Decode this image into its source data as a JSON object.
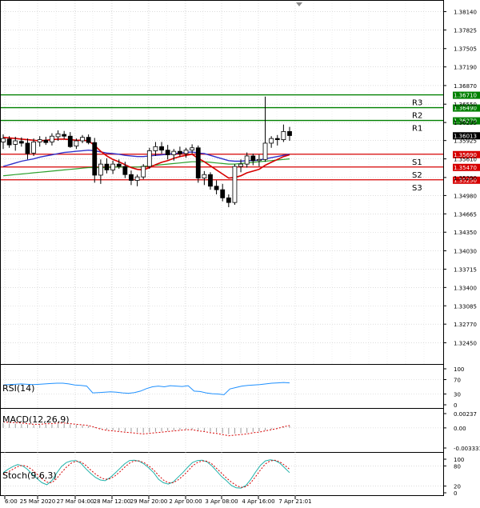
{
  "colors": {
    "background": "#ffffff",
    "grid": "#c8c8c8",
    "bull_candle": "#ffffff",
    "bear_candle": "#000000",
    "support": "#d60000",
    "resistance": "#008000",
    "ma_fast": "#d60000",
    "ma_slow": "#3030c8",
    "ma_long": "#2ca02c",
    "rsi": "#1e90ff",
    "macd": "#d60000",
    "stoch_main": "#20b2aa",
    "stoch_signal": "#d60000"
  },
  "chart_data": [
    {
      "type": "candlestick",
      "name": "price",
      "y_ticks": [
        "1.38140",
        "1.37825",
        "1.37505",
        "1.37190",
        "1.36870",
        "1.36550",
        "1.36235",
        "1.35925",
        "1.35610",
        "1.35290",
        "1.34980",
        "1.34665",
        "1.34350",
        "1.34030",
        "1.33715",
        "1.33400",
        "1.33085",
        "1.32770",
        "1.32450"
      ],
      "ylim": [
        1.3225,
        1.3823
      ],
      "x_ticks": [
        "6:00",
        "25 Mar 2020",
        "27 Mar 04:00",
        "28 Mar 12:00",
        "29 Mar 20:00",
        "2 Apr 00:00",
        "3 Apr 08:00",
        "4 Apr 16:00",
        "7 Apr 21:01"
      ],
      "candles": [
        [
          1.359,
          1.3603,
          1.3578,
          1.3596
        ],
        [
          1.3595,
          1.36,
          1.358,
          1.3585
        ],
        [
          1.3586,
          1.3599,
          1.3575,
          1.3592
        ],
        [
          1.3591,
          1.3598,
          1.3582,
          1.3588
        ],
        [
          1.3588,
          1.3596,
          1.356,
          1.357
        ],
        [
          1.3571,
          1.3596,
          1.3566,
          1.359
        ],
        [
          1.359,
          1.36,
          1.3582,
          1.3594
        ],
        [
          1.3593,
          1.3599,
          1.3585,
          1.3589
        ],
        [
          1.359,
          1.3605,
          1.3584,
          1.36
        ],
        [
          1.3599,
          1.361,
          1.3592,
          1.3604
        ],
        [
          1.3603,
          1.3609,
          1.3595,
          1.36
        ],
        [
          1.36,
          1.3607,
          1.358,
          1.3582
        ],
        [
          1.3583,
          1.3596,
          1.3578,
          1.3592
        ],
        [
          1.3592,
          1.3602,
          1.3588,
          1.3598
        ],
        [
          1.3598,
          1.3603,
          1.3586,
          1.3589
        ],
        [
          1.3589,
          1.3597,
          1.352,
          1.3533
        ],
        [
          1.3533,
          1.356,
          1.3518,
          1.3552
        ],
        [
          1.3552,
          1.3562,
          1.3536,
          1.3542
        ],
        [
          1.3542,
          1.3558,
          1.3535,
          1.3552
        ],
        [
          1.3552,
          1.356,
          1.3544,
          1.3548
        ],
        [
          1.3548,
          1.3556,
          1.3528,
          1.3534
        ],
        [
          1.3534,
          1.3541,
          1.3516,
          1.3524
        ],
        [
          1.3524,
          1.3534,
          1.3514,
          1.353
        ],
        [
          1.353,
          1.3552,
          1.3526,
          1.3548
        ],
        [
          1.3548,
          1.358,
          1.3544,
          1.3575
        ],
        [
          1.3575,
          1.359,
          1.3566,
          1.3582
        ],
        [
          1.3582,
          1.359,
          1.357,
          1.3576
        ],
        [
          1.3576,
          1.3585,
          1.356,
          1.3568
        ],
        [
          1.3568,
          1.3578,
          1.3558,
          1.3574
        ],
        [
          1.3574,
          1.3582,
          1.3565,
          1.357
        ],
        [
          1.357,
          1.358,
          1.3563,
          1.3576
        ],
        [
          1.3576,
          1.3586,
          1.357,
          1.358
        ],
        [
          1.358,
          1.3584,
          1.352,
          1.3528
        ],
        [
          1.3528,
          1.354,
          1.3516,
          1.3534
        ],
        [
          1.3534,
          1.3538,
          1.3508,
          1.3514
        ],
        [
          1.3514,
          1.3524,
          1.35,
          1.3508
        ],
        [
          1.3508,
          1.3518,
          1.3488,
          1.3494
        ],
        [
          1.3494,
          1.35,
          1.3478,
          1.3486
        ],
        [
          1.3486,
          1.3552,
          1.3482,
          1.3548
        ],
        [
          1.3548,
          1.356,
          1.3538,
          1.3552
        ],
        [
          1.3552,
          1.3572,
          1.3546,
          1.3566
        ],
        [
          1.3566,
          1.357,
          1.355,
          1.3558
        ],
        [
          1.3558,
          1.3568,
          1.3548,
          1.356
        ],
        [
          1.356,
          1.3668,
          1.3556,
          1.3588
        ],
        [
          1.3588,
          1.36,
          1.358,
          1.3596
        ],
        [
          1.3596,
          1.3602,
          1.3584,
          1.3594
        ],
        [
          1.3594,
          1.362,
          1.359,
          1.3608
        ],
        [
          1.3608,
          1.3616,
          1.3592,
          1.3601
        ]
      ],
      "ma_fast": [
        1.3598,
        1.3597,
        1.3596,
        1.3595,
        1.3594,
        1.3593,
        1.3592,
        1.3593,
        1.3594,
        1.3595,
        1.3595,
        1.3594,
        1.3593,
        1.3593,
        1.3592,
        1.3584,
        1.3574,
        1.3566,
        1.356,
        1.3556,
        1.3551,
        1.3546,
        1.3543,
        1.3542,
        1.3546,
        1.3551,
        1.3555,
        1.3558,
        1.3562,
        1.3565,
        1.3567,
        1.3569,
        1.3562,
        1.3556,
        1.3549,
        1.3542,
        1.3535,
        1.3528,
        1.3529,
        1.3532,
        1.3537,
        1.354,
        1.3543,
        1.355,
        1.3555,
        1.356,
        1.3565,
        1.3568
      ],
      "ma_slow": [
        1.3548,
        1.3551,
        1.3554,
        1.3557,
        1.3559,
        1.3561,
        1.3564,
        1.3566,
        1.3568,
        1.357,
        1.3572,
        1.3573,
        1.3574,
        1.3575,
        1.3576,
        1.3575,
        1.3573,
        1.3571,
        1.357,
        1.3569,
        1.3567,
        1.3566,
        1.3565,
        1.3565,
        1.3566,
        1.3567,
        1.3568,
        1.3569,
        1.357,
        1.3571,
        1.3572,
        1.3573,
        1.3571,
        1.357,
        1.3567,
        1.3564,
        1.3561,
        1.3558,
        1.3557,
        1.3557,
        1.3558,
        1.3558,
        1.3559,
        1.3561,
        1.3563,
        1.3565,
        1.3567,
        1.3569
      ],
      "ma_long": [
        1.3532,
        1.3533,
        1.3534,
        1.3535,
        1.3536,
        1.3537,
        1.3538,
        1.3539,
        1.354,
        1.3541,
        1.3542,
        1.3543,
        1.3544,
        1.3545,
        1.3546,
        1.3546,
        1.3546,
        1.3546,
        1.3547,
        1.3547,
        1.3547,
        1.3547,
        1.3547,
        1.3548,
        1.3549,
        1.355,
        1.3551,
        1.3552,
        1.3553,
        1.3554,
        1.3555,
        1.3556,
        1.3556,
        1.3556,
        1.3555,
        1.3554,
        1.3553,
        1.3552,
        1.3552,
        1.3553,
        1.3554,
        1.3555,
        1.3556,
        1.3557,
        1.3558,
        1.3559,
        1.356,
        1.3561
      ],
      "levels": [
        {
          "name": "R3",
          "price": 1.3671,
          "label": "1.36710",
          "kind": "resistance"
        },
        {
          "name": "R2",
          "price": 1.3649,
          "label": "1.36490",
          "kind": "resistance"
        },
        {
          "name": "R1",
          "price": 1.3627,
          "label": "1.36270",
          "kind": "resistance"
        },
        {
          "name": "S1",
          "price": 1.3569,
          "label": "1.35690",
          "kind": "support"
        },
        {
          "name": "S2",
          "price": 1.3547,
          "label": "1.35470",
          "kind": "support"
        },
        {
          "name": "S3",
          "price": 1.3525,
          "label": "1.35250",
          "kind": "support"
        }
      ],
      "current_price": {
        "price": 1.36013,
        "label": "1.36013"
      }
    },
    {
      "type": "line",
      "name": "RSI(14)",
      "ylim": [
        0,
        100
      ],
      "y_ticks": [
        "100",
        "70",
        "30",
        "0"
      ],
      "values": [
        55,
        56,
        57,
        58,
        57,
        56,
        57,
        58,
        59,
        60,
        60,
        58,
        55,
        54,
        52,
        33,
        34,
        35,
        36,
        35,
        33,
        32,
        34,
        38,
        45,
        50,
        52,
        50,
        53,
        52,
        51,
        53,
        38,
        37,
        33,
        31,
        30,
        28,
        44,
        48,
        52,
        54,
        55,
        56,
        58,
        60,
        61,
        62,
        61
      ]
    },
    {
      "type": "line",
      "name": "MACD(12,26,9)",
      "ylim": [
        -0.003331,
        0.00237
      ],
      "y_ticks": [
        "0.00237",
        "0.00",
        "-0.003331"
      ],
      "values": [
        0.001,
        0.0009,
        0.0009,
        0.0008,
        0.0007,
        0.0006,
        0.0006,
        0.0007,
        0.0007,
        0.0008,
        0.0008,
        0.0007,
        0.0006,
        0.0005,
        0.0004,
        0.0001,
        -0.0002,
        -0.0004,
        -0.0005,
        -0.0006,
        -0.0007,
        -0.0008,
        -0.0009,
        -0.001,
        -0.0009,
        -0.0008,
        -0.0007,
        -0.0006,
        -0.0005,
        -0.0004,
        -0.0003,
        -0.0003,
        -0.0005,
        -0.0006,
        -0.0008,
        -0.0009,
        -0.0011,
        -0.0013,
        -0.0012,
        -0.0011,
        -0.001,
        -0.0008,
        -0.0007,
        -0.0005,
        -0.0003,
        -0.0001,
        0.0002,
        0.0004
      ]
    },
    {
      "type": "line",
      "name": "Stoch(9,6,3)",
      "ylim": [
        0,
        100
      ],
      "y_ticks": [
        "100",
        "80",
        "20",
        "0"
      ],
      "main": [
        60,
        70,
        78,
        84,
        80,
        70,
        55,
        42,
        30,
        24,
        36,
        58,
        78,
        90,
        95,
        96,
        88,
        72,
        58,
        46,
        38,
        36,
        45,
        58,
        72,
        86,
        96,
        97,
        94,
        86,
        74,
        60,
        40,
        30,
        26,
        32,
        46,
        60,
        76,
        90,
        96,
        97,
        92,
        80,
        64,
        48,
        36,
        22,
        15,
        14,
        22,
        40,
        62,
        82,
        95,
        98,
        96,
        88,
        74,
        60
      ],
      "signal": [
        55,
        62,
        70,
        78,
        82,
        78,
        68,
        55,
        42,
        32,
        30,
        42,
        60,
        76,
        88,
        94,
        92,
        82,
        68,
        56,
        46,
        40,
        42,
        50,
        62,
        76,
        88,
        95,
        95,
        90,
        80,
        68,
        52,
        38,
        30,
        30,
        38,
        50,
        64,
        80,
        90,
        95,
        94,
        86,
        72,
        58,
        44,
        32,
        22,
        16,
        18,
        30,
        48,
        68,
        86,
        95,
        97,
        92,
        82,
        70
      ]
    }
  ]
}
